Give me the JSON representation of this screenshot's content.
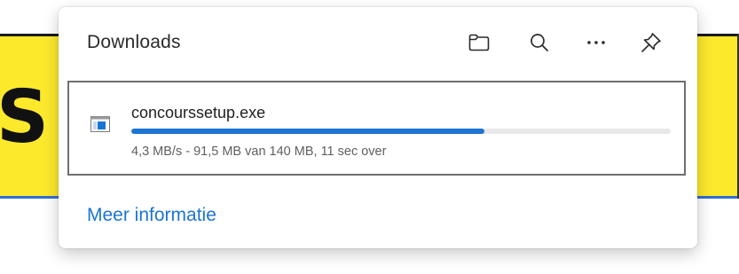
{
  "downloads_panel": {
    "title": "Downloads",
    "header_buttons": [
      {
        "icon": "folder-icon"
      },
      {
        "icon": "search-icon"
      },
      {
        "icon": "more-icon"
      },
      {
        "icon": "pin-icon"
      }
    ],
    "items": [
      {
        "icon": "executable-file-icon",
        "filename": "concourssetup.exe",
        "progress_fraction": 0.654,
        "status": "4,3 MB/s - 91,5 MB van 140 MB, 11 sec over"
      }
    ],
    "footer_link": "Meer informatie"
  },
  "background_page": {
    "visible_text": "S"
  },
  "colors": {
    "accent": "#1b74d4",
    "banner_yellow": "#fde92c",
    "item_border": "#6e6e6e",
    "progress_track": "#e8e8e8"
  }
}
